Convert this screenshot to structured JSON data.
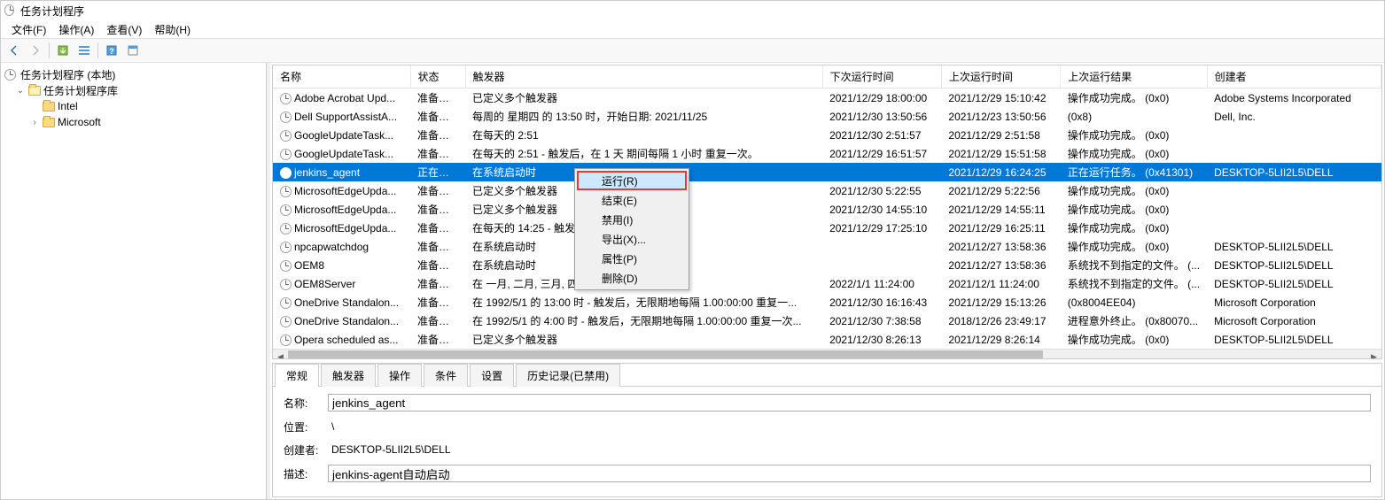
{
  "window": {
    "title": "任务计划程序"
  },
  "menubar": {
    "file": "文件(F)",
    "action": "操作(A)",
    "view": "查看(V)",
    "help": "帮助(H)"
  },
  "tree": {
    "root": "任务计划程序 (本地)",
    "lib": "任务计划程序库",
    "intel": "Intel",
    "microsoft": "Microsoft"
  },
  "grid": {
    "headers": {
      "name": "名称",
      "status": "状态",
      "trigger": "触发器",
      "next": "下次运行时间",
      "last": "上次运行时间",
      "result": "上次运行结果",
      "creator": "创建者"
    },
    "rows": [
      {
        "name": "Adobe Acrobat Upd...",
        "status": "准备就绪",
        "trigger": "已定义多个触发器",
        "next": "2021/12/29 18:00:00",
        "last": "2021/12/29 15:10:42",
        "result": "操作成功完成。  (0x0)",
        "creator": "Adobe Systems Incorporated"
      },
      {
        "name": "Dell SupportAssistA...",
        "status": "准备就绪",
        "trigger": "每周的 星期四 的 13:50 时，开始日期: 2021/11/25",
        "next": "2021/12/30 13:50:56",
        "last": "2021/12/23 13:50:56",
        "result": "(0x8)",
        "creator": "Dell, Inc."
      },
      {
        "name": "GoogleUpdateTask...",
        "status": "准备就绪",
        "trigger": "在每天的 2:51",
        "next": "2021/12/30 2:51:57",
        "last": "2021/12/29 2:51:58",
        "result": "操作成功完成。  (0x0)",
        "creator": ""
      },
      {
        "name": "GoogleUpdateTask...",
        "status": "准备就绪",
        "trigger": "在每天的 2:51 - 触发后，在 1 天 期间每隔 1 小时 重复一次。",
        "next": "2021/12/29 16:51:57",
        "last": "2021/12/29 15:51:58",
        "result": "操作成功完成。  (0x0)",
        "creator": ""
      },
      {
        "name": "jenkins_agent",
        "status": "正在运行",
        "trigger": "在系统启动时",
        "next": "",
        "last": "2021/12/29 16:24:25",
        "result": "正在运行任务。  (0x41301)",
        "creator": "DESKTOP-5LII2L5\\DELL",
        "selected": true
      },
      {
        "name": "MicrosoftEdgeUpda...",
        "status": "准备就绪",
        "trigger": "已定义多个触发器",
        "next": "2021/12/30 5:22:55",
        "last": "2021/12/29 5:22:56",
        "result": "操作成功完成。  (0x0)",
        "creator": ""
      },
      {
        "name": "MicrosoftEdgeUpda...",
        "status": "准备就绪",
        "trigger": "已定义多个触发器",
        "next": "2021/12/30 14:55:10",
        "last": "2021/12/29 14:55:11",
        "result": "操作成功完成。  (0x0)",
        "creator": ""
      },
      {
        "name": "MicrosoftEdgeUpda...",
        "status": "准备就绪",
        "trigger": "在每天的 14:25 - 触发                              小时 重复一次。",
        "next": "2021/12/29 17:25:10",
        "last": "2021/12/29 16:25:11",
        "result": "操作成功完成。  (0x0)",
        "creator": ""
      },
      {
        "name": "npcapwatchdog",
        "status": "准备就绪",
        "trigger": "在系统启动时",
        "next": "",
        "last": "2021/12/27 13:58:36",
        "result": "操作成功完成。  (0x0)",
        "creator": "DESKTOP-5LII2L5\\DELL"
      },
      {
        "name": "OEM8",
        "status": "准备就绪",
        "trigger": "在系统启动时",
        "next": "",
        "last": "2021/12/27 13:58:36",
        "result": "系统找不到指定的文件。  (...",
        "creator": "DESKTOP-5LII2L5\\DELL"
      },
      {
        "name": "OEM8Server",
        "status": "准备就绪",
        "trigger": "在 一月, 二月, 三月, 四                              , 九月, 十月, 十一月, ...",
        "next": "2022/1/1 11:24:00",
        "last": "2021/12/1 11:24:00",
        "result": "系统找不到指定的文件。  (...",
        "creator": "DESKTOP-5LII2L5\\DELL"
      },
      {
        "name": "OneDrive Standalon...",
        "status": "准备就绪",
        "trigger": "在 1992/5/1 的 13:00 时 - 触发后，无限期地每隔 1.00:00:00 重复一...",
        "next": "2021/12/30 16:16:43",
        "last": "2021/12/29 15:13:26",
        "result": "(0x8004EE04)",
        "creator": "Microsoft Corporation"
      },
      {
        "name": "OneDrive Standalon...",
        "status": "准备就绪",
        "trigger": "在 1992/5/1 的 4:00 时 - 触发后，无限期地每隔 1.00:00:00 重复一次...",
        "next": "2021/12/30 7:38:58",
        "last": "2018/12/26 23:49:17",
        "result": "进程意外终止。  (0x80070...",
        "creator": "Microsoft Corporation"
      },
      {
        "name": "Opera scheduled as...",
        "status": "准备就绪",
        "trigger": "已定义多个触发器",
        "next": "2021/12/30 8:26:13",
        "last": "2021/12/29 8:26:14",
        "result": "操作成功完成。  (0x0)",
        "creator": "DESKTOP-5LII2L5\\DELL"
      }
    ]
  },
  "context_menu": {
    "run": "运行(R)",
    "end": "结束(E)",
    "disable": "禁用(I)",
    "export": "导出(X)...",
    "properties": "属性(P)",
    "delete": "删除(D)"
  },
  "detail": {
    "tabs": {
      "general": "常规",
      "triggers": "触发器",
      "actions": "操作",
      "conditions": "条件",
      "settings": "设置",
      "history": "历史记录(已禁用)"
    },
    "labels": {
      "name": "名称:",
      "location": "位置:",
      "creator": "创建者:",
      "description": "描述:"
    },
    "values": {
      "name": "jenkins_agent",
      "location": "\\",
      "creator": "DESKTOP-5LII2L5\\DELL",
      "description": "jenkins-agent自动启动"
    }
  }
}
